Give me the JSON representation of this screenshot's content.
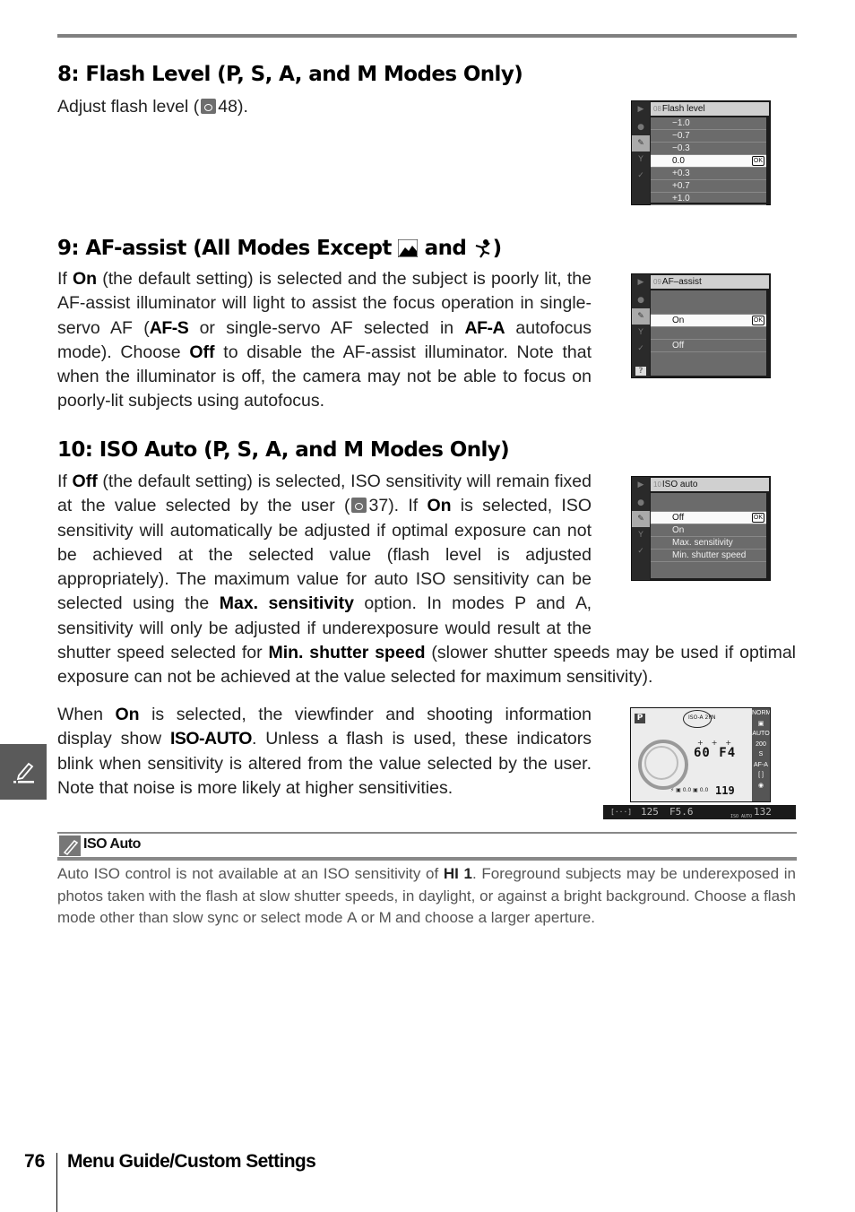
{
  "sections": [
    {
      "heading": "8: Flash Level (P, S, A, and M Modes Only)",
      "text_pre": "Adjust flash level (",
      "ref_page": "48",
      "text_post": ")."
    },
    {
      "heading_pre": "9: AF-assist  (All Modes Except",
      "heading_mid": "and",
      "heading_post": ")",
      "icons": [
        "landscape-mode-icon",
        "sports-mode-icon"
      ],
      "paragraph": {
        "p1": "If ",
        "b1": "On",
        "p2": " (the default setting) is selected and the subject is poorly lit, the AF-assist illuminator will light to assist the focus operation in single-servo AF (",
        "b2": "AF-S",
        "p3": " or single-servo AF selected in ",
        "b3": "AF-A",
        "p4": " autofocus mode).  Choose ",
        "b4": "Off",
        "p5": " to disable the AF-assist illuminator.  Note that when the illuminator is off, the camera may not be able to focus on poorly-lit subjects using autofocus."
      }
    },
    {
      "heading": "10: ISO Auto (P, S, A, and M Modes Only)",
      "paragraph1": {
        "p1": "If ",
        "b1": "Off",
        "p2": " (the default setting) is selected, ISO sensitivity will remain fixed at the value selected by the user (",
        "ref_page": "37",
        "p3": ").  If ",
        "b2": "On",
        "p4": " is selected, ISO sensitivity will automatically be adjusted if optimal exposure can not be achieved at the selected value (flash level is adjusted appropriately).  The maximum value for auto ISO sensitivity can be selected using the ",
        "b3": "Max. sensitivity",
        "p5": " option.  In modes ",
        "m1": "P",
        "p6": " and ",
        "m2": "A",
        "p7": ", sensitivity will only be adjusted if underexposure would result at the shutter speed selected for ",
        "b4": "Min. shutter speed",
        "p8": " (slower shutter speeds may be used if optimal exposure can not be achieved at the value selected for maximum sensitivity)."
      },
      "paragraph2": {
        "p1": "When ",
        "b1": "On",
        "p2": " is selected, the viewfinder and shooting information display show ",
        "b2": "ISO-AUTO",
        "p3": ".  Unless a flash is used, these indicators blink when sensitivity is altered from the value selected by the user.  Note that noise is more likely at higher sensitivities."
      }
    }
  ],
  "screens": {
    "flash_level": {
      "num": "08",
      "title": "Flash level",
      "options": [
        "−1.0",
        "−0.7",
        "−0.3",
        "0.0",
        "+0.3",
        "+0.7",
        "+1.0"
      ],
      "selected": 3,
      "ok": "OK"
    },
    "af_assist": {
      "num": "09",
      "title": "AF–assist",
      "options": [
        "On",
        "Off"
      ],
      "selected": 0,
      "ok": "OK",
      "help": "?"
    },
    "iso_auto": {
      "num": "10",
      "title": "ISO auto",
      "options": [
        "Off",
        "On",
        "Max. sensitivity",
        "Min. shutter speed"
      ],
      "selected": 0,
      "ok": "OK"
    },
    "side_icons": [
      "playback-icon",
      "camera-icon",
      "pencil-icon",
      "wrench-icon",
      "retouch-icon"
    ]
  },
  "info_display": {
    "mode": "P",
    "iso_indicator": "ISO-A 2PN",
    "shutter": "60",
    "aperture": "F4",
    "exp_comp": "0.0",
    "flash_comp": "0.0",
    "frames": "119",
    "right_column": [
      "NORM",
      "▣",
      "AUTO",
      "200",
      "S",
      "AF-A",
      "[ ]",
      "◉"
    ]
  },
  "viewfinder": {
    "shutter": "125",
    "aperture": "F5.6",
    "iso_label": "ISO AUTO",
    "frames": "132"
  },
  "note": {
    "title": "ISO Auto",
    "p1": "Auto ISO control is not available at an ISO sensitivity of ",
    "b1": "HI 1",
    "p2": ".  Foreground subjects may be underexposed in photos taken with the flash at slow shutter speeds, in daylight, or against a bright background.  Choose a flash mode other than slow sync or select mode ",
    "m1": "A",
    "p3": " or ",
    "m2": "M",
    "p4": " and choose a larger aperture."
  },
  "footer": {
    "page_number": "76",
    "section": "Menu Guide/Custom Settings"
  }
}
